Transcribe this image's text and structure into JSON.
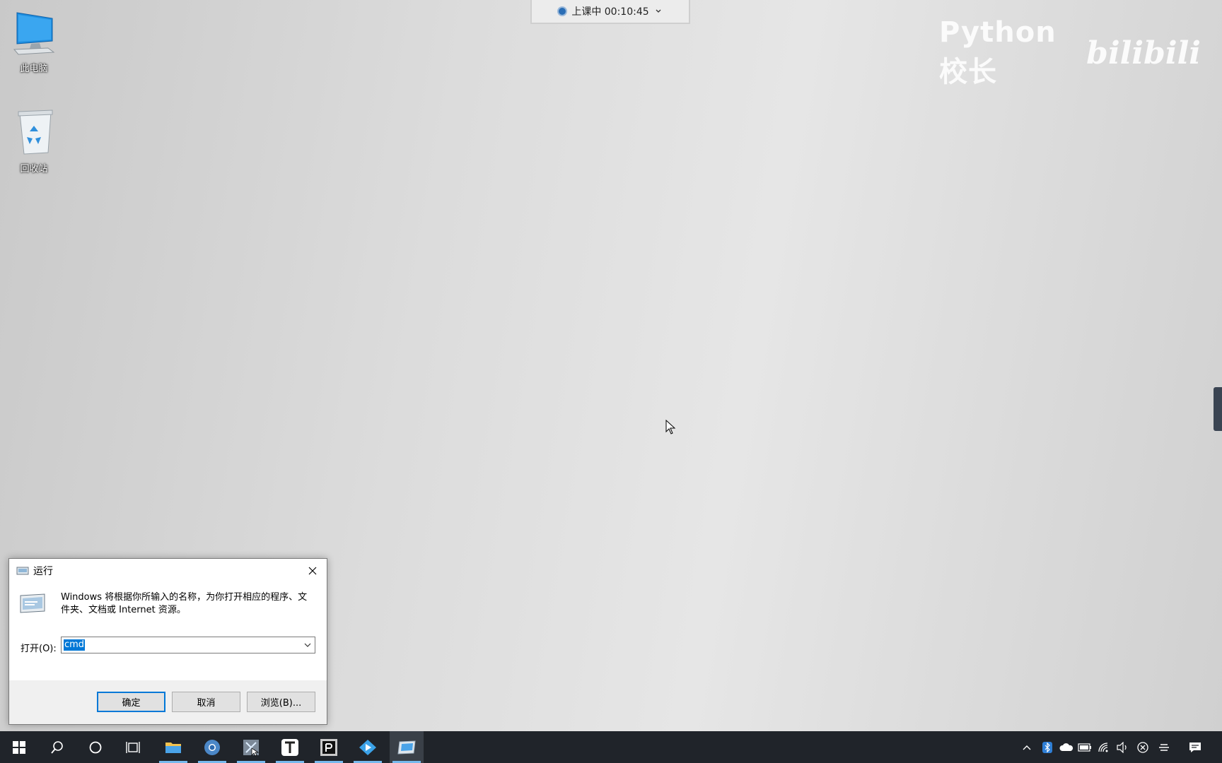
{
  "desktop": {
    "icons": [
      {
        "label": "此电脑",
        "icon": "computer-icon"
      },
      {
        "label": "回收站",
        "icon": "recycle-bin-icon"
      }
    ]
  },
  "class_status": {
    "text": "上课中 00:10:45",
    "icon": "recording-dot-icon",
    "dropdown_icon": "chevron-down-icon"
  },
  "watermark": {
    "name": "Python校长",
    "brand": "bilibili"
  },
  "run_dialog": {
    "title": "运行",
    "description": "Windows 将根据你所输入的名称，为你打开相应的程序、文件夹、文档或 Internet 资源。",
    "open_label": "打开(O):",
    "input_value": "cmd",
    "ok_label": "确定",
    "cancel_label": "取消",
    "browse_label": "浏览(B)..."
  },
  "taskbar": {
    "apps": [
      {
        "name": "start-button",
        "icon": "windows-icon"
      },
      {
        "name": "search-button",
        "icon": "search-icon"
      },
      {
        "name": "cortana-button",
        "icon": "circle-icon"
      },
      {
        "name": "task-view-button",
        "icon": "task-view-icon"
      },
      {
        "name": "file-explorer",
        "icon": "folder-icon"
      },
      {
        "name": "chrome",
        "icon": "chrome-icon"
      },
      {
        "name": "snipping-tool",
        "icon": "snip-icon"
      },
      {
        "name": "typora",
        "icon": "typora-icon"
      },
      {
        "name": "pycharm",
        "icon": "pycharm-icon"
      },
      {
        "name": "video-player",
        "icon": "play-icon"
      },
      {
        "name": "run-app",
        "icon": "run-icon"
      }
    ],
    "tray": [
      "chevron-up-icon",
      "bluetooth-icon",
      "cloud-icon",
      "battery-icon",
      "wifi-icon",
      "volume-icon",
      "close-circle-icon",
      "settings-icon",
      "notification-icon"
    ]
  },
  "colors": {
    "taskbar_bg": "#20242a",
    "accent": "#0078d7",
    "running_indicator": "#76b9ed"
  }
}
